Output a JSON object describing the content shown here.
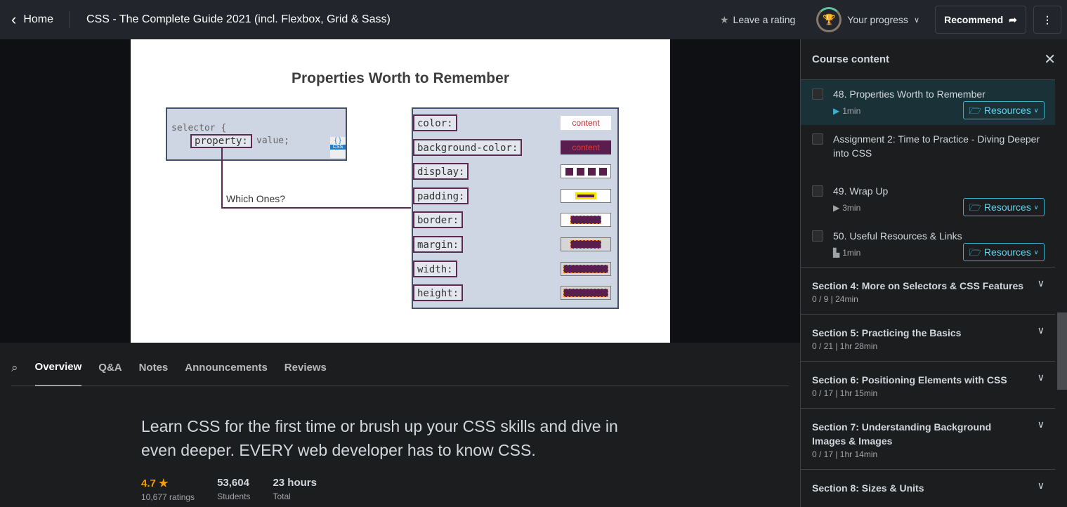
{
  "header": {
    "home_label": "Home",
    "course_title": "CSS - The Complete Guide 2021 (incl. Flexbox, Grid & Sass)",
    "rating_label": "Leave a rating",
    "progress_label": "Your progress",
    "recommend_label": "Recommend"
  },
  "slide": {
    "title": "Properties Worth to Remember",
    "code_selector": "selector {",
    "code_property": "property:",
    "code_value": "value;",
    "css_badge": "CSS",
    "arrow_label": "Which Ones?",
    "properties": [
      "color:",
      "background-color:",
      "display:",
      "padding:",
      "border:",
      "margin:",
      "width:",
      "height:"
    ],
    "demo_text": "content"
  },
  "tabs": [
    "Overview",
    "Q&A",
    "Notes",
    "Announcements",
    "Reviews"
  ],
  "overview": {
    "description": "Learn CSS for the first time or brush up your CSS skills and dive in even deeper. EVERY web developer has to know CSS.",
    "rating": "4.7",
    "ratings_count": "10,677 ratings",
    "students": "53,604",
    "students_label": "Students",
    "hours": "23 hours",
    "hours_label": "Total"
  },
  "sidebar": {
    "title": "Course content",
    "resources_label": "Resources",
    "items": [
      {
        "title": "48. Properties Worth to Remember",
        "duration": "1min",
        "icon": "play-icon",
        "current": true
      },
      {
        "title": "Assignment 2: Time to Practice - Diving Deeper into CSS"
      },
      {
        "title": "49. Wrap Up",
        "duration": "3min",
        "icon": "play-icon"
      },
      {
        "title": "50. Useful Resources & Links",
        "duration": "1min",
        "icon": "file-icon"
      }
    ],
    "sections": [
      {
        "title": "Section 4: More on Selectors & CSS Features",
        "meta": "0 / 9 | 24min"
      },
      {
        "title": "Section 5: Practicing the Basics",
        "meta": "0 / 21 | 1hr 28min"
      },
      {
        "title": "Section 6: Positioning Elements with CSS",
        "meta": "0 / 17 | 1hr 15min"
      },
      {
        "title": "Section 7: Understanding Background Images & Images",
        "meta": "0 / 17 | 1hr 14min"
      },
      {
        "title": "Section 8: Sizes & Units",
        "meta": ""
      }
    ]
  },
  "colors": {
    "accent": "#5fd6ef",
    "rating": "#f69c08",
    "slide_purple": "#5a1e4e"
  }
}
